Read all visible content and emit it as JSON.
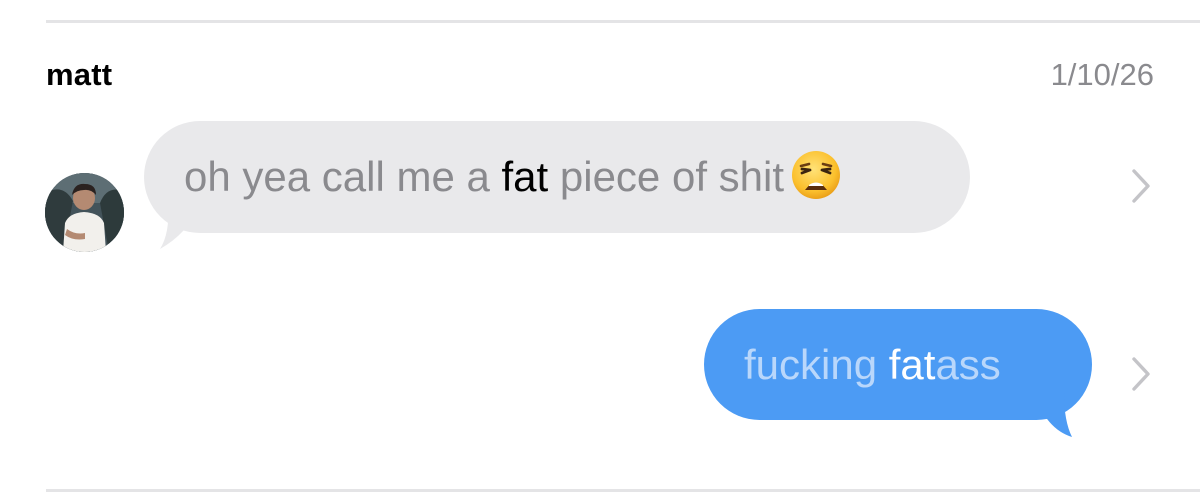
{
  "header": {
    "sender": "matt",
    "date": "1/10/26"
  },
  "messages": [
    {
      "direction": "incoming",
      "before": "oh yea call me a ",
      "highlight": "fat",
      "after": " piece of shit",
      "emoji": "weary-face-emoji"
    },
    {
      "direction": "outgoing",
      "before": "fucking ",
      "highlight": "fat",
      "after": "ass"
    }
  ],
  "colors": {
    "incoming_bubble": "#e9e9eb",
    "outgoing_bubble": "#4c9bf4",
    "muted_text": "#8a8a8e",
    "divider": "#e4e4e6"
  },
  "icons": {
    "avatar": "profile-photo",
    "disclosure": "chevron-right-icon"
  }
}
